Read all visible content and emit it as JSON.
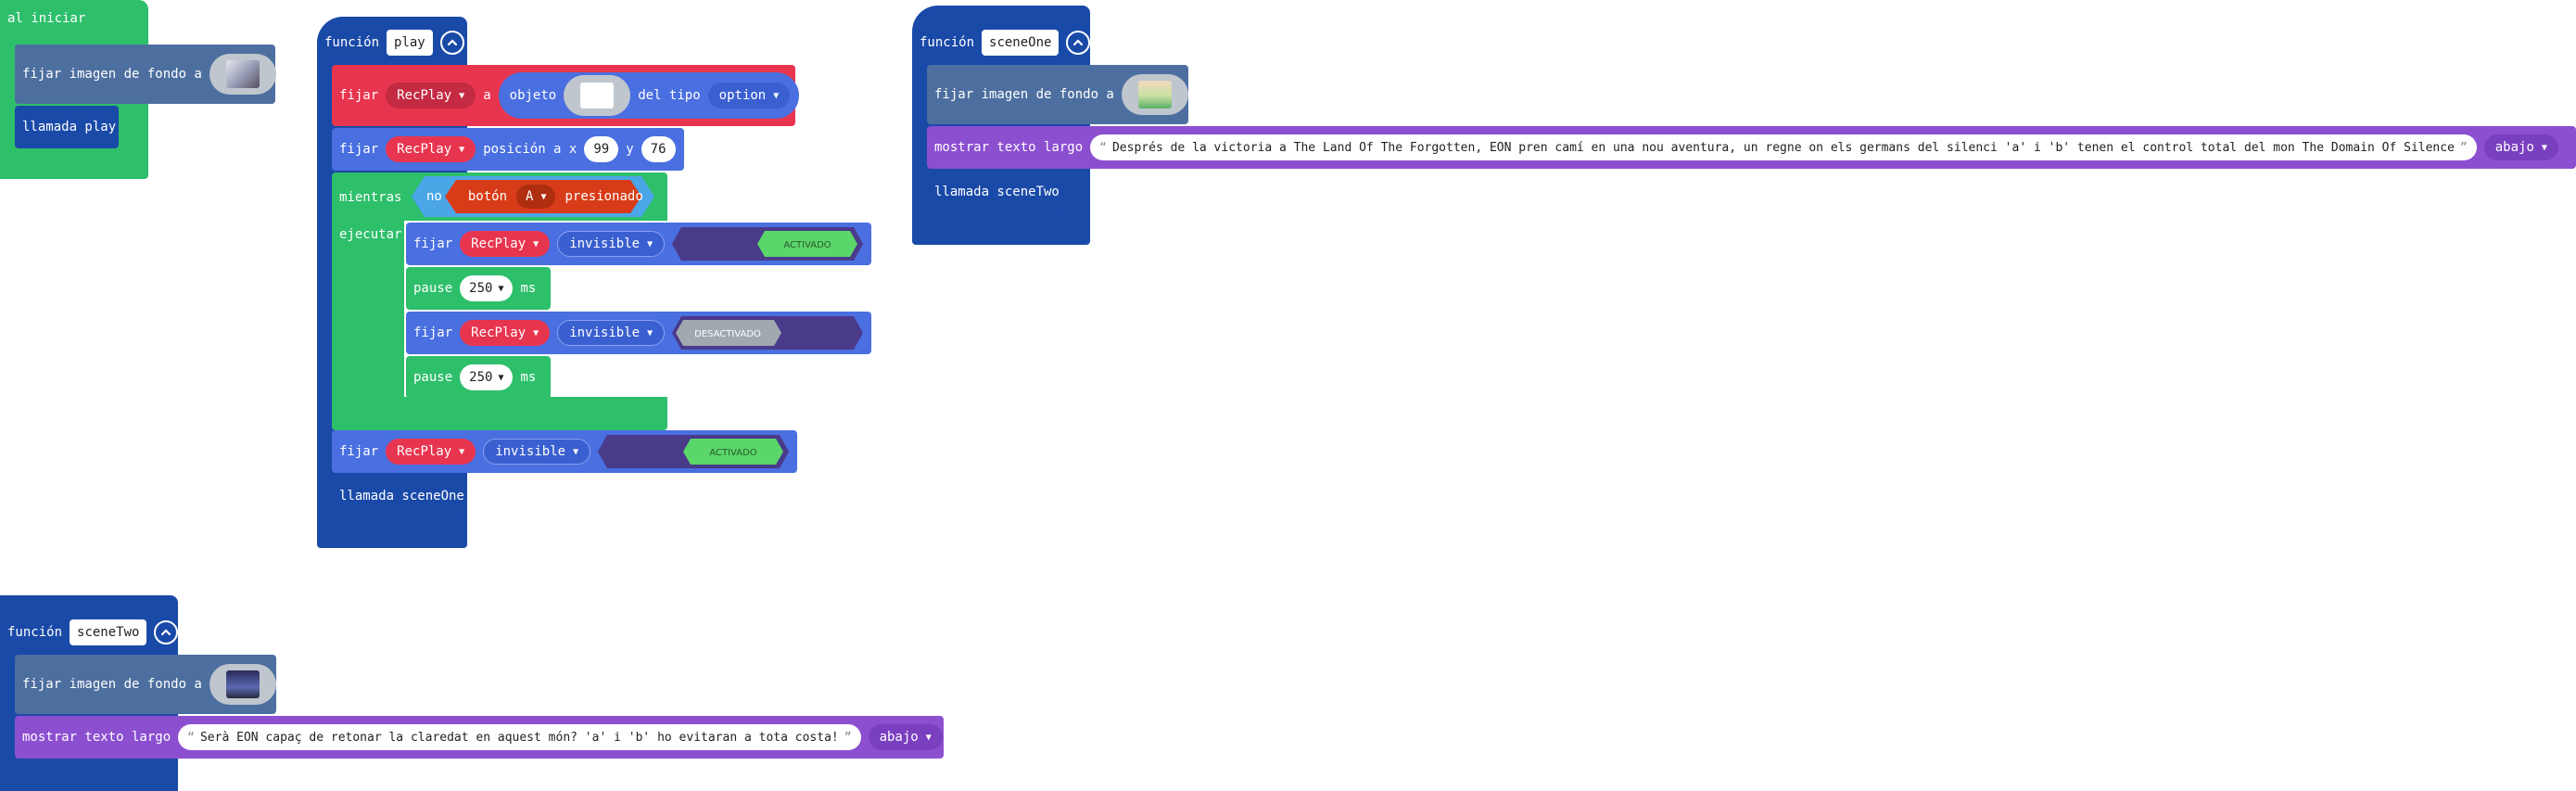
{
  "colors": {
    "events": "#2ebf6b",
    "functions": "#1a4aa8",
    "sprites": "#4a6fe0",
    "scene": "#4d6fa0",
    "text": "#8c4fd0",
    "loops": "#2ebf6b",
    "sprite_var": "#e8354f",
    "controller": "#d83b17",
    "logic": "#4aa6e6",
    "toggle_dark": "#4a3a8a",
    "toggle_on": "#5ad66a",
    "toggle_off": "#a0a8b0"
  },
  "on_start": {
    "label": "al iniciar",
    "set_bg_label": "fijar imagen de fondo a",
    "call_label": "llamada play"
  },
  "fn_play": {
    "kw_function": "función",
    "name": "play",
    "collapse_icon": "chevron-up-icon",
    "set_sprite": {
      "kw_set": "fijar",
      "var": "RecPlay",
      "kw_to": "a",
      "kw_object": "objeto",
      "kw_of_kind": "del tipo",
      "kind": "option"
    },
    "set_pos": {
      "kw_set": "fijar",
      "var": "RecPlay",
      "kw_pos": "posición a x",
      "x": "99",
      "kw_y": "y",
      "y": "76"
    },
    "while": {
      "kw_while": "mientras",
      "kw_not": "no",
      "kw_button": "botón",
      "button": "A",
      "kw_pressed": "presionado",
      "kw_do": "ejecutar"
    },
    "loop_body": [
      {
        "kw_set": "fijar",
        "var": "RecPlay",
        "prop": "invisible",
        "state": "ACTIVADO"
      },
      {
        "kw_pause": "pause",
        "value": "250",
        "unit": "ms"
      },
      {
        "kw_set": "fijar",
        "var": "RecPlay",
        "prop": "invisible",
        "state": "DESACTIVADO"
      },
      {
        "kw_pause": "pause",
        "value": "250",
        "unit": "ms"
      }
    ],
    "after_loop": {
      "kw_set": "fijar",
      "var": "RecPlay",
      "prop": "invisible",
      "state": "ACTIVADO"
    },
    "call_label": "llamada sceneOne"
  },
  "fn_scene_one": {
    "kw_function": "función",
    "name": "sceneOne",
    "set_bg_label": "fijar imagen de fondo a",
    "show_text_label": "mostrar texto largo",
    "text": "Després de la victoria a The Land Of The Forgotten, EON pren camí en una nou aventura, un regne on els germans del silenci 'a' i 'b' tenen el control total del mon The Domain Of Silence",
    "position": "abajo",
    "call_label": "llamada sceneTwo"
  },
  "fn_scene_two": {
    "kw_function": "función",
    "name": "sceneTwo",
    "set_bg_label": "fijar imagen de fondo a",
    "show_text_label": "mostrar texto largo",
    "text": "Serà EON capaç de retonar la claredat en aquest món? 'a' i 'b' ho evitaran a tota costa!",
    "position": "abajo"
  }
}
